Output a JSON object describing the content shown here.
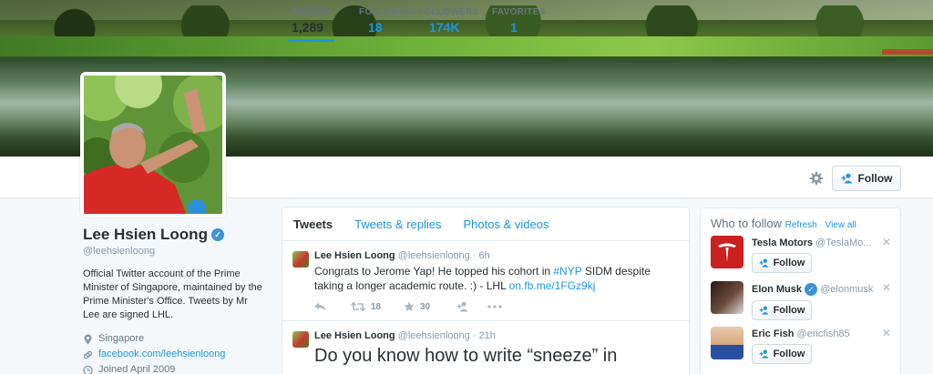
{
  "profile": {
    "name": "Lee Hsien Loong",
    "handle": "@leehsienloong",
    "bio": "Official Twitter account of the Prime Minister of Singapore, maintained by the Prime Minister's Office. Tweets by Mr Lee are signed LHL.",
    "location": "Singapore",
    "website": "facebook.com/leehsienloong",
    "joined": "Joined April 2009"
  },
  "stats": {
    "tweets_label": "TWEETS",
    "tweets_value": "1,289",
    "following_label": "FOLLOWING",
    "following_value": "18",
    "followers_label": "FOLLOWERS",
    "followers_value": "174K",
    "favorites_label": "FAVORITES",
    "favorites_value": "1"
  },
  "header": {
    "follow_label": "Follow"
  },
  "tabs": {
    "tweets": "Tweets",
    "replies": "Tweets & replies",
    "photos": "Photos & videos"
  },
  "tweets": [
    {
      "name": "Lee Hsien Loong",
      "handle": "@leehsienloong",
      "time": "· 6h",
      "text_a": "Congrats to Jerome Yap! He topped his cohort in ",
      "hashtag": "#NYP",
      "text_b": " SIDM despite taking a longer academic route. :) - LHL ",
      "link": "on.fb.me/1FGz9kj",
      "retweets": "18",
      "favorites": "30"
    },
    {
      "name": "Lee Hsien Loong",
      "handle": "@leehsienloong",
      "time": "· 21h",
      "text": "Do you know how to write “sneeze” in"
    }
  ],
  "who_to_follow": {
    "title": "Who to follow",
    "refresh": "Refresh",
    "sep": " · ",
    "view_all": "View all",
    "follow_label": "Follow",
    "items": [
      {
        "name": "Tesla Motors",
        "handle": "@TeslaMo..."
      },
      {
        "name": "Elon Musk",
        "handle": "@elonmusk"
      },
      {
        "name": "Eric Fish",
        "handle": "@ericfish85"
      }
    ]
  },
  "icons": [
    "gear-icon",
    "follow-person-icon",
    "verified-badge-icon",
    "location-pin-icon",
    "link-icon",
    "clock-icon",
    "reply-icon",
    "retweet-icon",
    "favorite-star-icon",
    "follow-user-icon",
    "more-dots-icon",
    "close-icon"
  ],
  "colors": {
    "link": "#1b95e0",
    "text": "#292f33",
    "muted": "#8899a6",
    "background": "#f5f8fa"
  }
}
